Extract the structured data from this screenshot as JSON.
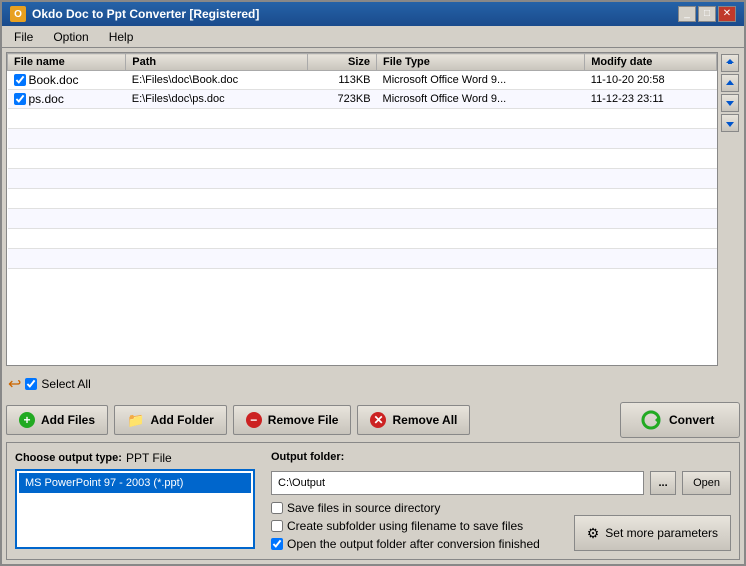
{
  "window": {
    "title": "Okdo Doc to Ppt Converter [Registered]",
    "icon": "O"
  },
  "menu": {
    "items": [
      "File",
      "Option",
      "Help"
    ]
  },
  "table": {
    "columns": [
      "File name",
      "Path",
      "Size",
      "File Type",
      "Modify date"
    ],
    "rows": [
      {
        "checked": true,
        "name": "Book.doc",
        "path": "E:\\Files\\doc\\Book.doc",
        "size": "113KB",
        "type": "Microsoft Office Word 9...",
        "date": "11-10-20 20:58"
      },
      {
        "checked": true,
        "name": "ps.doc",
        "path": "E:\\Files\\doc\\ps.doc",
        "size": "723KB",
        "type": "Microsoft Office Word 9...",
        "date": "11-12-23 23:11"
      }
    ]
  },
  "side_buttons": {
    "up_top": "⇈",
    "up": "↑",
    "down": "↓",
    "down_bottom": "⇊"
  },
  "checkbox_row": {
    "select_all_label": "Select All"
  },
  "toolbar": {
    "add_files": "Add Files",
    "add_folder": "Add Folder",
    "remove_file": "Remove File",
    "remove_all": "Remove All",
    "convert": "Convert"
  },
  "output_type": {
    "label": "Choose output type:",
    "type_name": "PPT File",
    "formats": [
      "MS PowerPoint 97 - 2003 (*.ppt)"
    ]
  },
  "output_folder": {
    "label": "Output folder:",
    "path": "C:\\Output",
    "browse_label": "...",
    "open_label": "Open",
    "options": [
      {
        "label": "Save files in source directory",
        "checked": false
      },
      {
        "label": "Create subfolder using filename to save files",
        "checked": false
      },
      {
        "label": "Open the output folder after conversion finished",
        "checked": true
      }
    ],
    "params_btn": "Set more parameters"
  }
}
